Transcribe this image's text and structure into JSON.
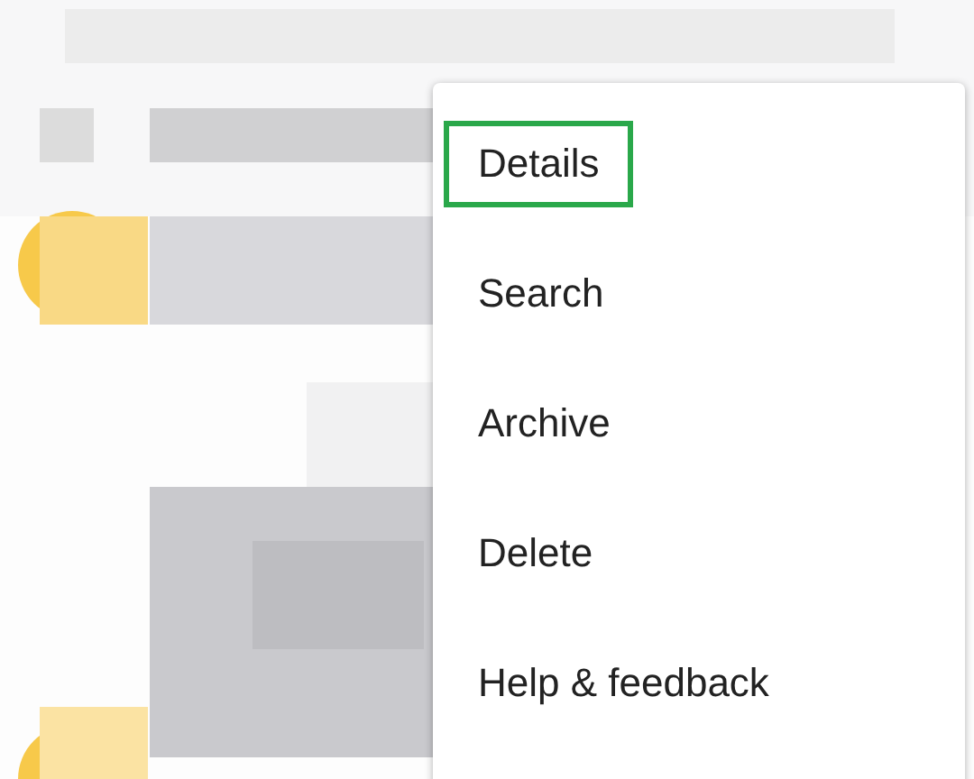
{
  "menu": {
    "items": [
      {
        "label": "Details",
        "highlighted": true
      },
      {
        "label": "Search",
        "highlighted": false
      },
      {
        "label": "Archive",
        "highlighted": false
      },
      {
        "label": "Delete",
        "highlighted": false
      },
      {
        "label": "Help & feedback",
        "highlighted": false
      }
    ]
  }
}
